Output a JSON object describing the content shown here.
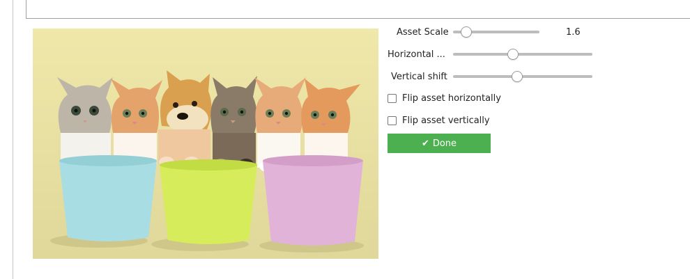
{
  "controls": {
    "asset_scale": {
      "label": "Asset Scale",
      "value": "1.6",
      "level": 0.15
    },
    "horizontal_shift": {
      "label": "Horizontal ...",
      "level": 0.43
    },
    "vertical_shift": {
      "label": "Vertical shift",
      "level": 0.46
    },
    "flip_horizontal": {
      "label": "Flip asset horizontally",
      "checked": false
    },
    "flip_vertical": {
      "label": "Flip asset vertically",
      "checked": false
    },
    "done_button": {
      "label": "Done",
      "icon": "check-icon"
    }
  },
  "colors": {
    "accent": "#4caf50",
    "image_background": "#ece5a6"
  }
}
